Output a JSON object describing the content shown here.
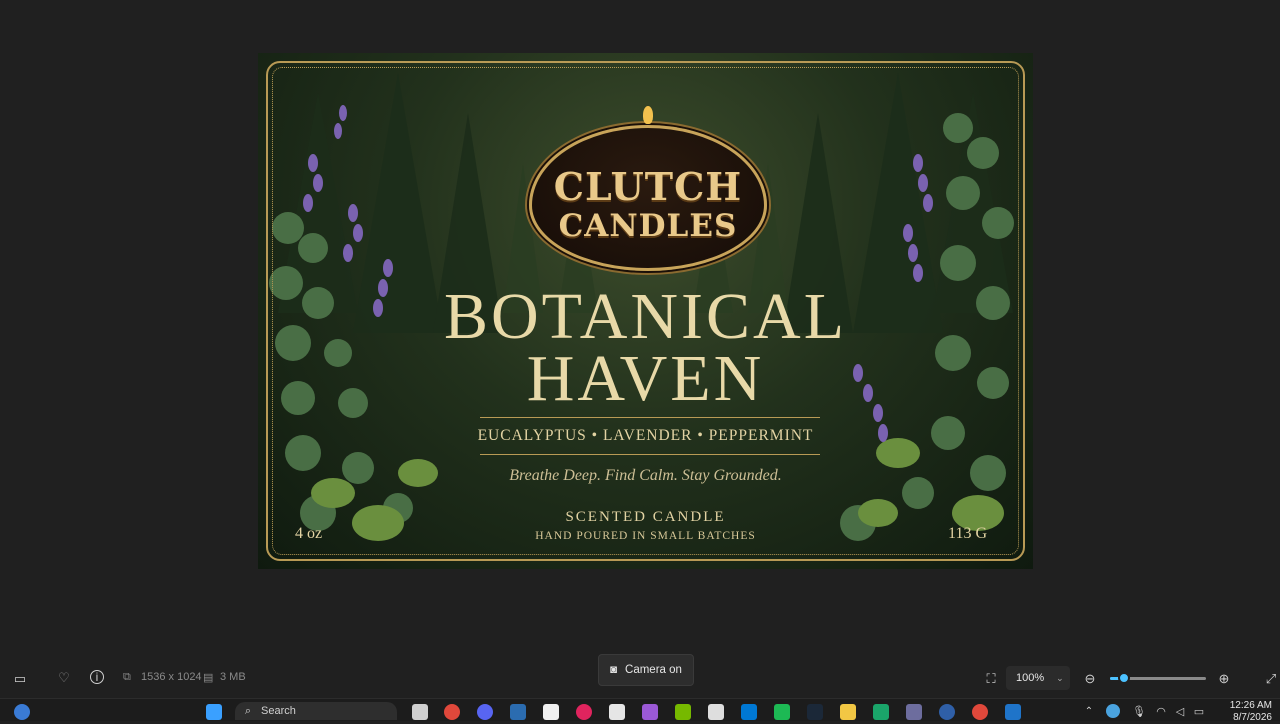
{
  "image": {
    "brand_line1": "CLUTCH",
    "brand_line2": "CANDLES",
    "title_line1": "BOTANICAL",
    "title_line2": "HAVEN",
    "ingredients": "EUCALYPTUS • LAVENDER • PEPPERMINT",
    "tagline": "Breathe Deep. Find Calm. Stay Grounded.",
    "product_type": "SCENTED CANDLE",
    "subtitle": "HAND POURED IN SMALL BATCHES",
    "weight_oz": "4 oz",
    "weight_g": "113 G"
  },
  "viewer": {
    "dimensions": "1536 x 1024",
    "file_size": "3 MB",
    "camera_toast": "Camera on",
    "zoom_value": "100%",
    "zoom_slider_fraction": 0.15
  },
  "taskbar": {
    "search_placeholder": "Search",
    "time": "12:26 AM",
    "date": "8/7/2026"
  },
  "colors": {
    "accent": "#4cc2ff",
    "gold": "#b89a55",
    "forest": "#22311c"
  }
}
